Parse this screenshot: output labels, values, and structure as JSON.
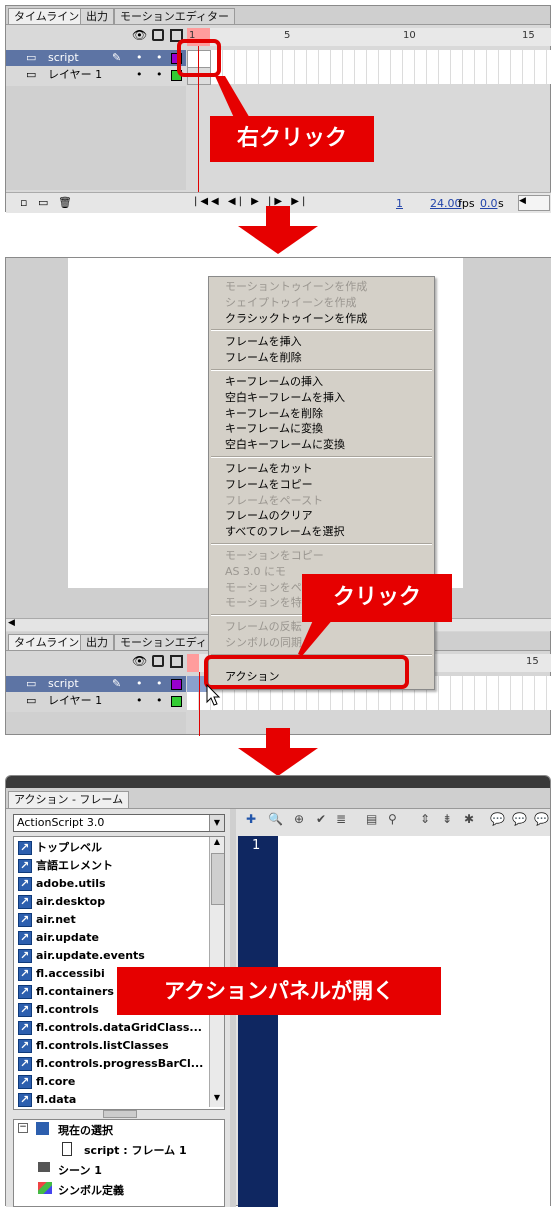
{
  "panel1": {
    "tabs": [
      "タイムライン",
      "出力",
      "モーションエディター"
    ],
    "ruler": [
      "1",
      "5",
      "10",
      "15"
    ],
    "layers": [
      {
        "name": "script",
        "selected": true,
        "color": "#9900cc"
      },
      {
        "name": "レイヤー 1",
        "selected": false,
        "color": "#33cc33"
      }
    ],
    "status": {
      "frame": "1",
      "fps": "24.00",
      "fps_unit": "fps",
      "time": "0.0",
      "time_unit": "s"
    },
    "callout": "右クリック"
  },
  "panel2": {
    "tabs": [
      "タイムライン",
      "出力",
      "モーションエディター"
    ],
    "ruler_last": "15",
    "layers": [
      {
        "name": "script",
        "selected": true,
        "color": "#9900cc"
      },
      {
        "name": "レイヤー 1",
        "selected": false,
        "color": "#33cc33"
      }
    ],
    "menu_groups": [
      [
        {
          "label": "モーショントゥイーンを作成",
          "enabled": false
        },
        {
          "label": "シェイプトゥイーンを作成",
          "enabled": false
        },
        {
          "label": "クラシックトゥイーンを作成",
          "enabled": true
        }
      ],
      [
        {
          "label": "フレームを挿入",
          "enabled": true
        },
        {
          "label": "フレームを削除",
          "enabled": true
        }
      ],
      [
        {
          "label": "キーフレームの挿入",
          "enabled": true
        },
        {
          "label": "空白キーフレームを挿入",
          "enabled": true
        },
        {
          "label": "キーフレームを削除",
          "enabled": true
        },
        {
          "label": "キーフレームに変換",
          "enabled": true
        },
        {
          "label": "空白キーフレームに変換",
          "enabled": true
        }
      ],
      [
        {
          "label": "フレームをカット",
          "enabled": true
        },
        {
          "label": "フレームをコピー",
          "enabled": true
        },
        {
          "label": "フレームをペースト",
          "enabled": false
        },
        {
          "label": "フレームのクリア",
          "enabled": true
        },
        {
          "label": "すべてのフレームを選択",
          "enabled": true
        }
      ],
      [
        {
          "label": "モーションをコピー",
          "enabled": false
        },
        {
          "label": "AS 3.0 にモ",
          "enabled": false
        },
        {
          "label": "モーションをペ",
          "enabled": false
        },
        {
          "label": "モーションを特",
          "enabled": false
        }
      ],
      [
        {
          "label": "フレームの反転",
          "enabled": false
        },
        {
          "label": "シンボルの同期",
          "enabled": false
        }
      ]
    ],
    "menu_action": "アクション",
    "callout": "クリック"
  },
  "panel3": {
    "title": "アクション - フレーム",
    "dropdown_value": "ActionScript 3.0",
    "tree_items": [
      "トップレベル",
      "言語エレメント",
      "adobe.utils",
      "air.desktop",
      "air.net",
      "air.update",
      "air.update.events",
      "fl.accessibi",
      "fl.containers",
      "fl.controls",
      "fl.controls.dataGridClass...",
      "fl.controls.listClasses",
      "fl.controls.progressBarCl...",
      "fl.core",
      "fl.data"
    ],
    "nav": {
      "current_selection": "現在の選択",
      "script_frame": "script : フレーム 1",
      "scene": "シーン 1",
      "symbols": "シンボル定義"
    },
    "line_number": "1",
    "callout": "アクションパネルが開く"
  }
}
